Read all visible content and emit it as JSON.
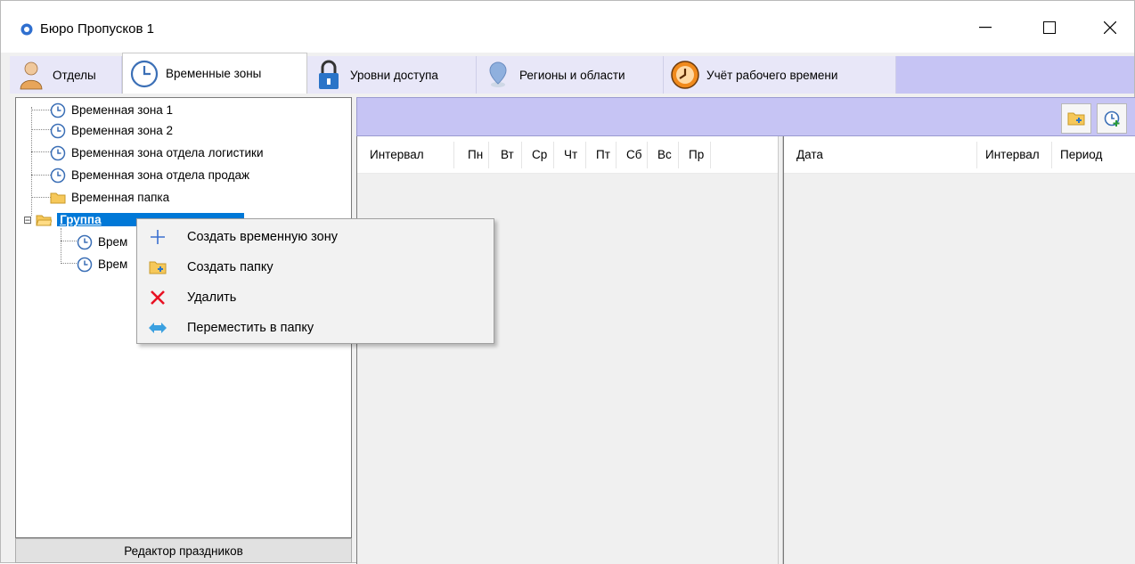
{
  "window": {
    "title": "Бюро Пропусков 1"
  },
  "tabs": [
    {
      "label": "Отделы",
      "icon": "person-icon"
    },
    {
      "label": "Временные зоны",
      "icon": "clock-icon",
      "active": true
    },
    {
      "label": "Уровни доступа",
      "icon": "padlock-icon"
    },
    {
      "label": "Регионы и области",
      "icon": "map-pin-icon"
    },
    {
      "label": "Учёт рабочего времени",
      "icon": "alarm-clock-icon"
    }
  ],
  "tree": {
    "items": [
      {
        "label": "Временная зона 1",
        "icon": "clock-icon"
      },
      {
        "label": "Временная зона 2",
        "icon": "clock-icon"
      },
      {
        "label": "Временная зона отдела логистики",
        "icon": "clock-icon"
      },
      {
        "label": "Временная зона отдела продаж",
        "icon": "clock-icon"
      },
      {
        "label": "Временная папка",
        "icon": "folder-icon"
      },
      {
        "label": "Группа",
        "icon": "folder-open-icon",
        "selected": true,
        "expanded": true
      },
      {
        "label": "Врем",
        "icon": "clock-icon"
      },
      {
        "label": "Врем",
        "icon": "clock-icon"
      }
    ],
    "expand_glyph": "⊟"
  },
  "holidays_button": "Редактор праздников",
  "schedule_columns": [
    "Интервал",
    "Пн",
    "Вт",
    "Ср",
    "Чт",
    "Пт",
    "Сб",
    "Вс",
    "Пр"
  ],
  "dates_columns": [
    "Дата",
    "Интервал",
    "Период"
  ],
  "context_menu": [
    {
      "label": "Создать временную зону",
      "icon": "plus-icon"
    },
    {
      "label": "Создать папку",
      "icon": "folder-add-icon"
    },
    {
      "label": "Удалить",
      "icon": "delete-x-icon"
    },
    {
      "label": "Переместить в папку",
      "icon": "move-arrows-icon"
    }
  ],
  "colors": {
    "accent": "#0078d7",
    "tab_strip": "#c6c4f4",
    "delete_red": "#e81123"
  }
}
